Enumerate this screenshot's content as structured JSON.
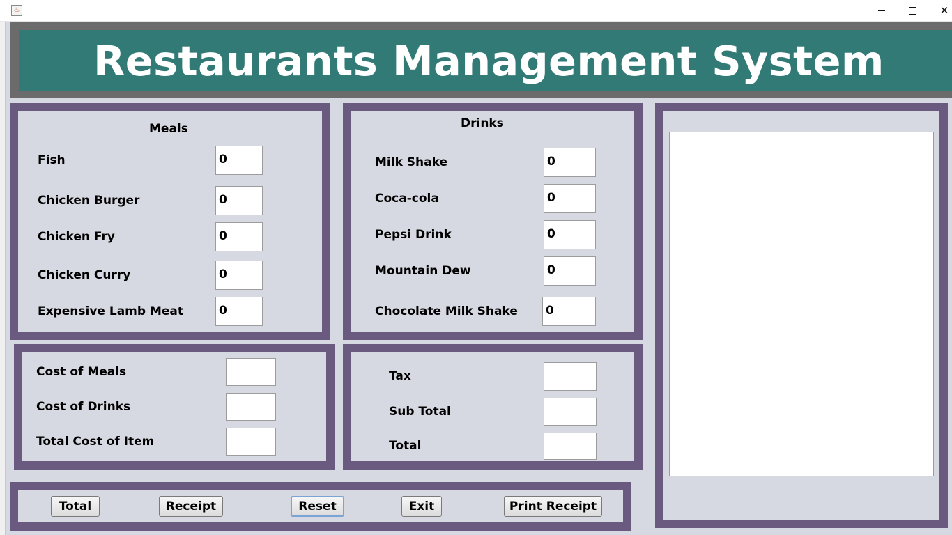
{
  "window": {
    "icon": "java-icon"
  },
  "header": {
    "title": "Restaurants Management System"
  },
  "meals": {
    "title": "Meals",
    "items": [
      {
        "label": "Fish",
        "value": "0"
      },
      {
        "label": "Chicken Burger",
        "value": "0"
      },
      {
        "label": "Chicken Fry",
        "value": "0"
      },
      {
        "label": "Chicken Curry",
        "value": "0"
      },
      {
        "label": "Expensive Lamb Meat",
        "value": "0"
      }
    ]
  },
  "drinks": {
    "title": "Drinks",
    "items": [
      {
        "label": "Milk Shake",
        "value": "0"
      },
      {
        "label": "Coca-cola",
        "value": "0"
      },
      {
        "label": "Pepsi Drink",
        "value": "0"
      },
      {
        "label": "Mountain Dew",
        "value": "0"
      },
      {
        "label": "Chocolate Milk Shake",
        "value": "0"
      }
    ]
  },
  "costs": {
    "items": [
      {
        "label": "Cost of Meals",
        "value": ""
      },
      {
        "label": "Cost of Drinks",
        "value": ""
      },
      {
        "label": "Total Cost of Item",
        "value": ""
      }
    ]
  },
  "totals": {
    "items": [
      {
        "label": "Tax",
        "value": ""
      },
      {
        "label": "Sub Total",
        "value": ""
      },
      {
        "label": "Total",
        "value": ""
      }
    ]
  },
  "receipt": {
    "text": ""
  },
  "buttons": {
    "total": "Total",
    "receipt": "Receipt",
    "reset": "Reset",
    "exit": "Exit",
    "print_receipt": "Print Receipt"
  },
  "colors": {
    "header_bg": "#317a76",
    "header_frame": "#6b6b6b",
    "panel_border": "#6a5a80",
    "panel_bg": "#d7d9e2"
  }
}
